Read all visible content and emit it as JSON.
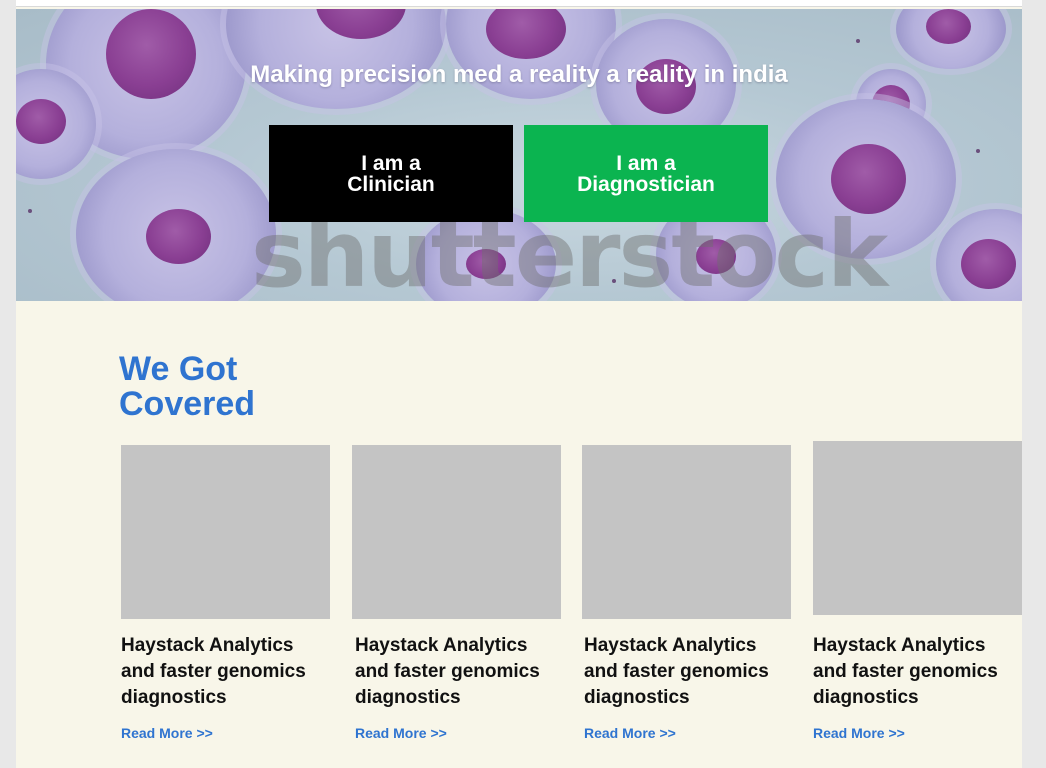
{
  "hero": {
    "title": "Making precision med a reality a reality in india",
    "watermark": "shutterstock",
    "buttons": [
      {
        "label": "I am a\nClinician",
        "color": "#000000"
      },
      {
        "label": "I am a\nDiagnostician",
        "color": "#0bb450"
      }
    ]
  },
  "covered": {
    "heading": "We Got\nCovered",
    "heading_color": "#2f74d0",
    "cards": [
      {
        "title": "Haystack Analytics and faster genomics diagnostics",
        "link": "Read More >>"
      },
      {
        "title": "Haystack Analytics and faster genomics diagnostics",
        "link": "Read More >>"
      },
      {
        "title": "Haystack Analytics and faster genomics diagnostics",
        "link": "Read More >>"
      },
      {
        "title": "Haystack Analytics and faster genomics diagnostics",
        "link": "Read More >>"
      }
    ]
  }
}
